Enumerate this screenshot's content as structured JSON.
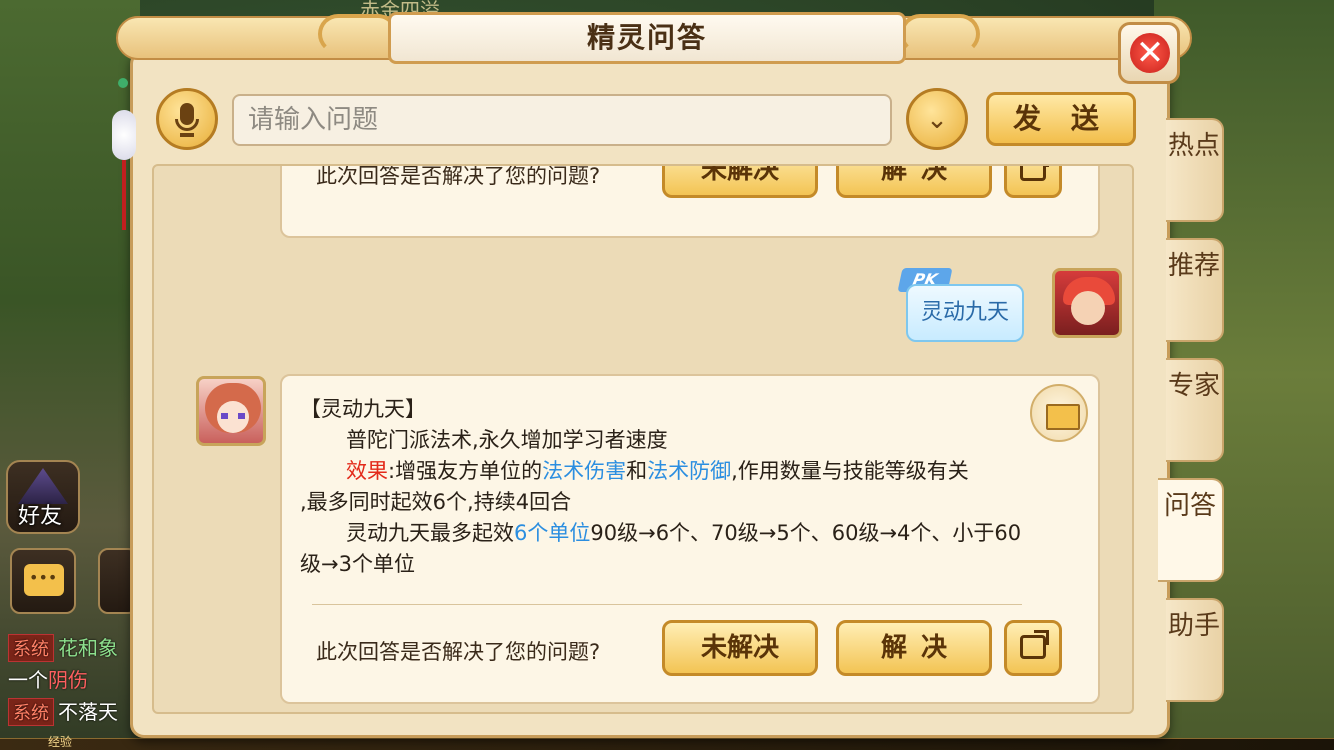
{
  "background": {
    "top_text": "赤金四溢",
    "friend_label": "好友",
    "chat_lines": [
      {
        "tag": "系统",
        "text": "花和象"
      },
      {
        "tag": "",
        "text": "一个",
        "highlight": "阴伤"
      },
      {
        "tag": "系统",
        "text": "不落天"
      }
    ],
    "exp_label": "经验"
  },
  "dialog": {
    "title": "精灵问答",
    "input_placeholder": "请输入问题",
    "send_label": "发 送"
  },
  "conversation": {
    "prev_card": {
      "question": "此次回答是否解决了您的问题?",
      "unresolved_label": "未解决",
      "resolved_label": "解决"
    },
    "user_message": {
      "badge": "PK",
      "text": "灵动九天"
    },
    "answer": {
      "heading": "【灵动九天】",
      "line1": "普陀门派法术,永久增加学习者速度",
      "effect_label": "效果",
      "effect_pre": ":增强友方单位的",
      "effect_link1": "法术伤害",
      "effect_mid": "和",
      "effect_link2": "法术防御",
      "effect_post": ",作用数量与技能等级有关",
      "line3": ",最多同时起效6个,持续4回合",
      "line4_pre": "灵动九天最多起效",
      "line4_link": "6个单位",
      "line4_post": "90级→6个、70级→5个、60级→4个、小于60",
      "line5": "级→3个单位",
      "question": "此次回答是否解决了您的问题?",
      "unresolved_label": "未解决",
      "resolved_label": "解决"
    }
  },
  "tabs": [
    {
      "label": "热点",
      "active": false
    },
    {
      "label": "推荐",
      "active": false
    },
    {
      "label": "专家",
      "active": false
    },
    {
      "label": "问答",
      "active": true
    },
    {
      "label": "助手",
      "active": false
    }
  ],
  "colors": {
    "accent_red": "#e32a1a",
    "link_blue": "#2b8ee0",
    "panel_bg": "#f2e3c2",
    "button_gold": "#f3c454"
  }
}
